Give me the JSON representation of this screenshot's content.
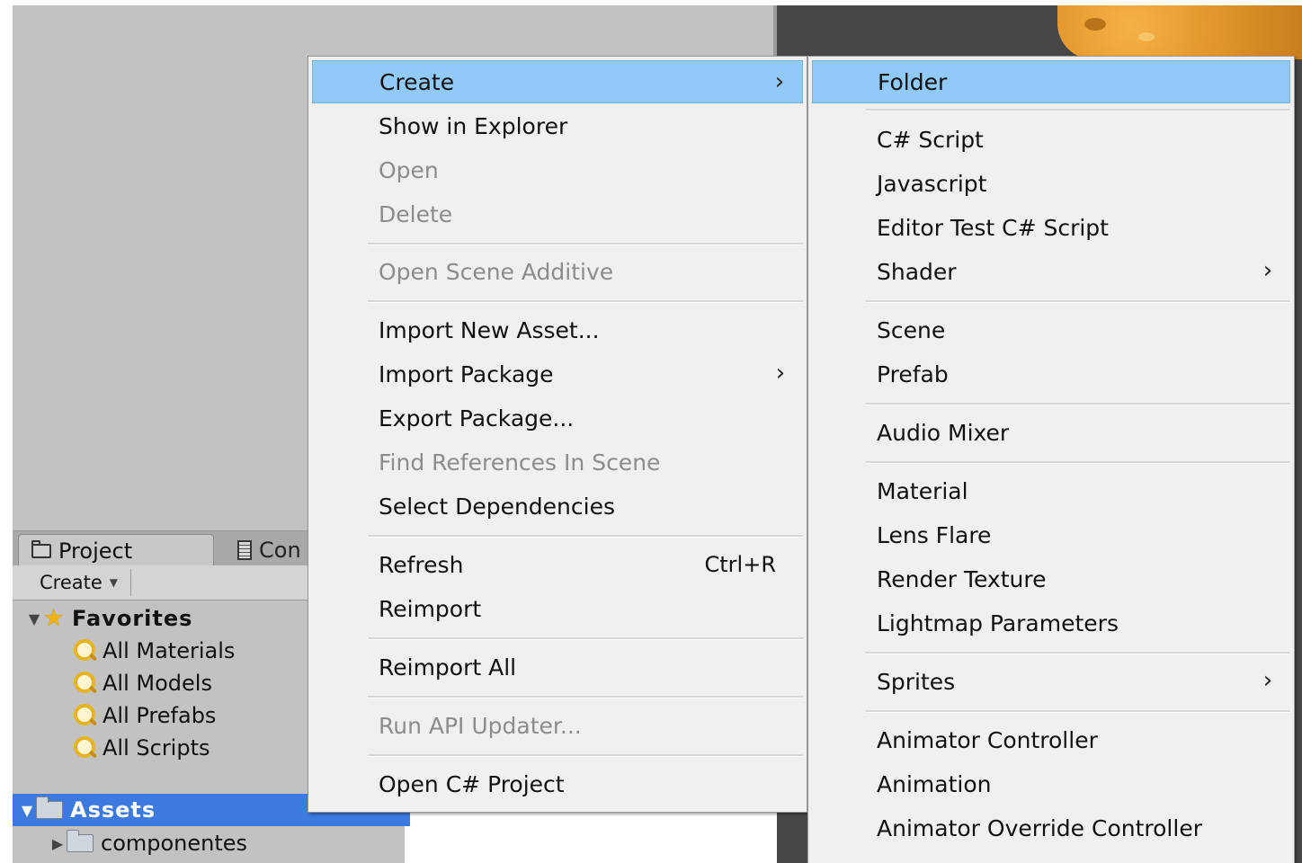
{
  "project_panel": {
    "tabs": [
      {
        "label": "Project",
        "icon": "folder-icon"
      },
      {
        "label": "Con",
        "icon": "console-icon"
      }
    ],
    "create_button": "Create",
    "favorites_label": "Favorites",
    "favorites": [
      "All Materials",
      "All Models",
      "All Prefabs",
      "All Scripts"
    ],
    "assets_label": "Assets",
    "assets_children": [
      "componentes"
    ]
  },
  "context_menu": {
    "items": [
      {
        "label": "Create",
        "submenu": true,
        "highlighted": true
      },
      {
        "label": "Show in Explorer"
      },
      {
        "label": "Open",
        "disabled": true
      },
      {
        "label": "Delete",
        "disabled": true
      },
      {
        "label": "Open Scene Additive",
        "disabled": true
      },
      {
        "label": "Import New Asset..."
      },
      {
        "label": "Import Package",
        "submenu": true
      },
      {
        "label": "Export Package..."
      },
      {
        "label": "Find References In Scene",
        "disabled": true
      },
      {
        "label": "Select Dependencies"
      },
      {
        "label": "Refresh",
        "shortcut": "Ctrl+R"
      },
      {
        "label": "Reimport"
      },
      {
        "label": "Reimport All"
      },
      {
        "label": "Run API Updater...",
        "disabled": true
      },
      {
        "label": "Open C# Project"
      }
    ]
  },
  "create_submenu": {
    "items": [
      {
        "label": "Folder",
        "highlighted": true
      },
      {
        "label": "C# Script"
      },
      {
        "label": "Javascript"
      },
      {
        "label": "Editor Test C# Script"
      },
      {
        "label": "Shader",
        "submenu": true
      },
      {
        "label": "Scene"
      },
      {
        "label": "Prefab"
      },
      {
        "label": "Audio Mixer"
      },
      {
        "label": "Material"
      },
      {
        "label": "Lens Flare"
      },
      {
        "label": "Render Texture"
      },
      {
        "label": "Lightmap Parameters"
      },
      {
        "label": "Sprites",
        "submenu": true
      },
      {
        "label": "Animator Controller"
      },
      {
        "label": "Animation"
      },
      {
        "label": "Animator Override Controller"
      }
    ]
  },
  "colors": {
    "menu_highlight": "#91c9f7",
    "selection_blue": "#3d7ae0",
    "disabled_text": "#8c8c8c",
    "panel_gray": "#c2c2c2",
    "game_view": "#474747"
  }
}
